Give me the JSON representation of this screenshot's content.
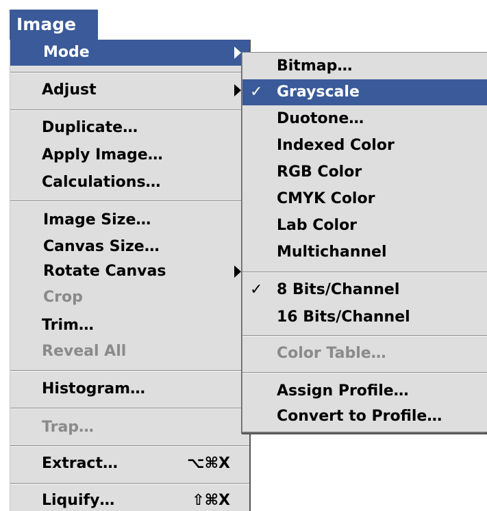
{
  "menu_title": "Image",
  "main_menu": {
    "mode": "Mode",
    "adjust": "Adjust",
    "duplicate": "Duplicate…",
    "apply_image": "Apply Image…",
    "calculations": "Calculations…",
    "image_size": "Image Size…",
    "canvas_size": "Canvas Size…",
    "rotate_canvas": "Rotate Canvas",
    "crop": "Crop",
    "trim": "Trim…",
    "reveal_all": "Reveal All",
    "histogram": "Histogram…",
    "trap": "Trap…",
    "extract": "Extract…",
    "extract_shortcut": "⌥⌘X",
    "liquify": "Liquify…",
    "liquify_shortcut": "⇧⌘X"
  },
  "submenu": {
    "bitmap": "Bitmap…",
    "grayscale": "Grayscale",
    "duotone": "Duotone…",
    "indexed_color": "Indexed Color",
    "rgb_color": "RGB Color",
    "cmyk_color": "CMYK Color",
    "lab_color": "Lab Color",
    "multichannel": "Multichannel",
    "bits8": "8 Bits/Channel",
    "bits16": "16 Bits/Channel",
    "color_table": "Color Table…",
    "assign_profile": "Assign Profile…",
    "convert_profile": "Convert to Profile…",
    "checkmark": "✓"
  },
  "colors": {
    "highlight": "#3a5a99",
    "menu_bg": "#dedede",
    "disabled_text": "#8a8a8a"
  },
  "icons": {
    "submenu_arrow": "triangle-right-icon",
    "check": "checkmark-icon"
  }
}
